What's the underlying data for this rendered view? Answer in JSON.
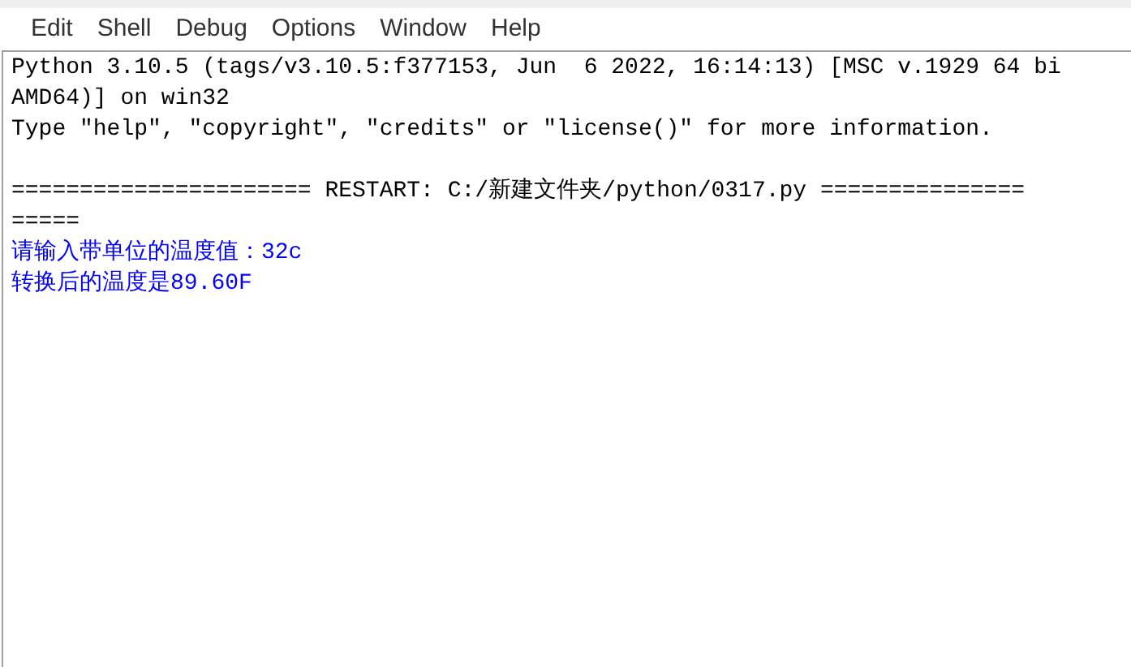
{
  "menu": [
    "Edit",
    "Shell",
    "Debug",
    "Options",
    "Window",
    "Help"
  ],
  "shell_lines": [
    {
      "kind": "system",
      "text": "Python 3.10.5 (tags/v3.10.5:f377153, Jun  6 2022, 16:14:13) [MSC v.1929 64 bi"
    },
    {
      "kind": "system",
      "text": "AMD64)] on win32"
    },
    {
      "kind": "system",
      "text": "Type \"help\", \"copyright\", \"credits\" or \"license()\" for more information."
    },
    {
      "kind": "blank"
    },
    {
      "kind": "system",
      "text": "====================== RESTART: C:/新建文件夹/python/0317.py ==============="
    },
    {
      "kind": "system",
      "text": "====="
    },
    {
      "kind": "output",
      "text": "请输入带单位的温度值：32c"
    },
    {
      "kind": "output",
      "text": "转换后的温度是89.60F"
    }
  ]
}
